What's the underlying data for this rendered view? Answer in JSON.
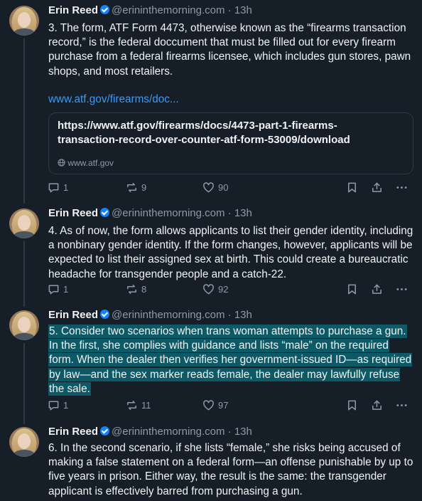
{
  "posts": [
    {
      "author": "Erin Reed",
      "handle": "@erininthemorning.com",
      "time": "13h",
      "text": "3. The form, ATF Form 4473, otherwise known as the “firearms transaction record,” is the federal doccument that must be filled out for every firearm purchase from a federal firearms licensee, which includes gun stores, pawn shops, and most retailers.",
      "link": "www.atf.gov/firearms/doc...",
      "card_title": "https://www.atf.gov/firearms/docs/4473-part-1-firearms-transaction-record-over-counter-atf-form-53009/download",
      "card_domain": "www.atf.gov",
      "replies": "1",
      "reposts": "9",
      "likes": "90"
    },
    {
      "author": "Erin Reed",
      "handle": "@erininthemorning.com",
      "time": "13h",
      "text": "4. As of now, the form allows applicants to list their gender identity, including a nonbinary gender identity. If the form changes, however, applicants will be expected to list their assigned sex at birth. This could create a bureaucratic headache for transgender people and a catch-22.",
      "replies": "1",
      "reposts": "8",
      "likes": "92"
    },
    {
      "author": "Erin Reed",
      "handle": "@erininthemorning.com",
      "time": "13h",
      "text": "5. Consider two scenarios when trans woman attempts to purchase a gun. In the first, she complies with guidance and lists “male” on the required form. When the dealer then verifies her government-issued ID—as required by law—and the sex marker reads female, the dealer may lawfully refuse the sale.",
      "replies": "1",
      "reposts": "11",
      "likes": "97"
    },
    {
      "author": "Erin Reed",
      "handle": "@erininthemorning.com",
      "time": "13h",
      "text": "6. In the second scenario, if she lists “female,” she risks being accused of making a false statement on a federal form—an offense punishable by up to five years in prison. Either way, the result is the same: the transgender applicant is effectively barred from purchasing a gun."
    }
  ],
  "icons": [
    "avatar",
    "verified-icon",
    "reply-icon",
    "repost-icon",
    "like-icon",
    "bookmark-icon",
    "share-icon",
    "more-icon",
    "globe-icon"
  ],
  "colors": {
    "background": "#161e27",
    "link": "#3b9af7",
    "highlight": "#0d5a66",
    "verified": "#1083fe"
  }
}
